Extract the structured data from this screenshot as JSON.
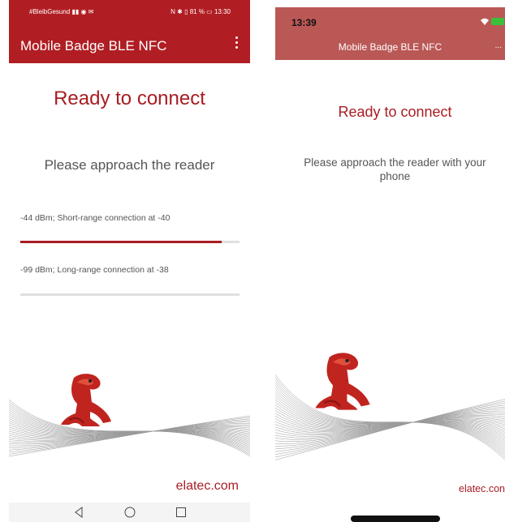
{
  "android": {
    "status": {
      "carrier": "#BleibGesund",
      "right": "81 %",
      "time": "13:30"
    },
    "app_title": "Mobile Badge BLE NFC",
    "ready": "Ready to connect",
    "approach": "Please approach the reader",
    "short_range": {
      "label": "-44 dBm; Short-range connection at -40",
      "progress": 0.92
    },
    "long_range": {
      "label": "-99 dBm; Long-range connection at -38",
      "progress": 0.0
    },
    "footer": "elatec.com",
    "nav_icons": [
      "back-icon",
      "home-icon",
      "recents-icon"
    ]
  },
  "ios": {
    "time": "13:39",
    "title": "Mobile Badge BLE NFC",
    "more": "...",
    "ready": "Ready to connect",
    "approach": "Please approach the reader with your phone",
    "footer": "elatec.con"
  },
  "colors": {
    "brand": "#b01e23",
    "ios_header": "#ba5856",
    "text_gray": "#555555"
  }
}
